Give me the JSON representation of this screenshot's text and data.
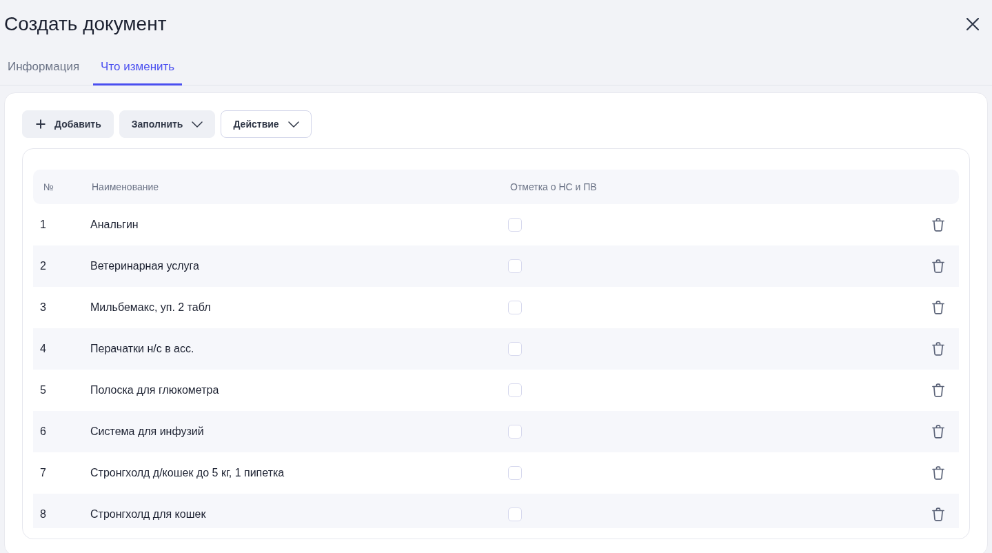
{
  "window": {
    "title": "Создать документ"
  },
  "tabs": [
    {
      "label": "Информация",
      "selected": false
    },
    {
      "label": "Что изменить",
      "selected": true
    }
  ],
  "toolbar": [
    {
      "label": "Добавить",
      "kind": "add",
      "outlined": false
    },
    {
      "label": "Заполнить",
      "kind": "menu",
      "outlined": false
    },
    {
      "label": "Действие",
      "kind": "menu",
      "outlined": true
    }
  ],
  "table": {
    "columns": [
      "№",
      "Наименование",
      "Отметка о НС и ПВ"
    ],
    "rows": [
      {
        "number": "1",
        "name": "Анальгин",
        "checked": false
      },
      {
        "number": "2",
        "name": "Ветеринарная услуга",
        "checked": false
      },
      {
        "number": "3",
        "name": "Мильбемакс, уп. 2 табл",
        "checked": false
      },
      {
        "number": "4",
        "name": "Перачатки н/с в асс.",
        "checked": false
      },
      {
        "number": "5",
        "name": "Полоска для глюкометра",
        "checked": false
      },
      {
        "number": "6",
        "name": "Система для инфузий",
        "checked": false
      },
      {
        "number": "7",
        "name": "Стронгхолд д/кошек до 5 кг, 1 пипетка",
        "checked": false
      },
      {
        "number": "8",
        "name": "Стронгхолд для кошек",
        "checked": false
      }
    ]
  }
}
